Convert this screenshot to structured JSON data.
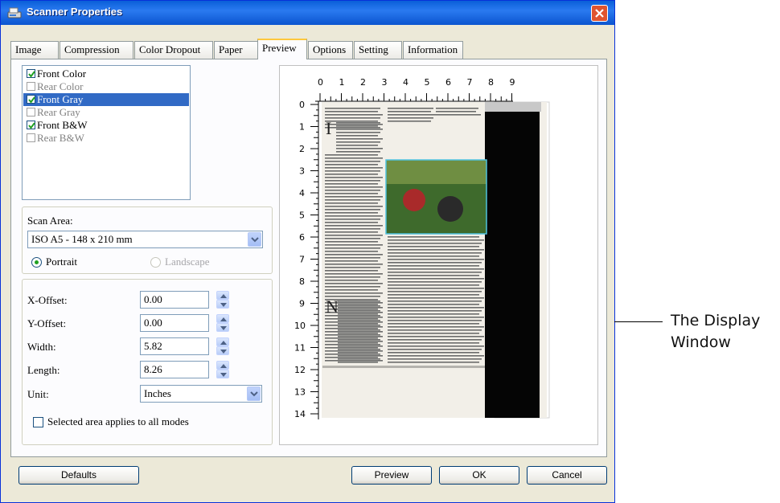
{
  "window": {
    "title": "Scanner Properties"
  },
  "tabs": [
    {
      "label": "Image",
      "active": false
    },
    {
      "label": "Compression",
      "active": false
    },
    {
      "label": "Color Dropout",
      "active": false
    },
    {
      "label": "Paper",
      "active": false
    },
    {
      "label": "Preview",
      "active": true
    },
    {
      "label": "Options",
      "active": false
    },
    {
      "label": "Setting",
      "active": false
    },
    {
      "label": "Information",
      "active": false
    }
  ],
  "image_modes": [
    {
      "label": "Front Color",
      "checked": true,
      "enabled": true,
      "selected": false
    },
    {
      "label": "Rear Color",
      "checked": false,
      "enabled": false,
      "selected": false
    },
    {
      "label": "Front Gray",
      "checked": true,
      "enabled": true,
      "selected": true
    },
    {
      "label": "Rear Gray",
      "checked": false,
      "enabled": false,
      "selected": false
    },
    {
      "label": "Front B&W",
      "checked": true,
      "enabled": true,
      "selected": false
    },
    {
      "label": "Rear B&W",
      "checked": false,
      "enabled": false,
      "selected": false
    }
  ],
  "scan_area": {
    "label": "Scan Area:",
    "value": "ISO A5 - 148 x 210 mm",
    "portrait_label": "Portrait",
    "landscape_label": "Landscape",
    "orientation": "Portrait"
  },
  "offsets": {
    "x_label": "X-Offset:",
    "x_value": "0.00",
    "y_label": "Y-Offset:",
    "y_value": "0.00",
    "width_label": "Width:",
    "width_value": "5.82",
    "length_label": "Length:",
    "length_value": "8.26",
    "unit_label": "Unit:",
    "unit_value": "Inches"
  },
  "apply_all": {
    "label": "Selected area applies to all modes",
    "checked": false
  },
  "ruler": {
    "x_ticks": [
      "0",
      "1",
      "2",
      "3",
      "4",
      "5",
      "6",
      "7",
      "8",
      "9"
    ],
    "y_ticks": [
      "0",
      "1",
      "2",
      "3",
      "4",
      "5",
      "6",
      "7",
      "8",
      "9",
      "10",
      "11",
      "12",
      "13",
      "14"
    ]
  },
  "buttons": {
    "defaults": "Defaults",
    "preview": "Preview",
    "ok": "OK",
    "cancel": "Cancel"
  },
  "callout": {
    "line1": "The Display",
    "line2": "Window"
  },
  "colors": {
    "title_bar": "#0a5fd8",
    "selection": "#316ac5",
    "active_tab_accent": "#ffc83c",
    "scan_area_outline": "#4fc3e0"
  }
}
